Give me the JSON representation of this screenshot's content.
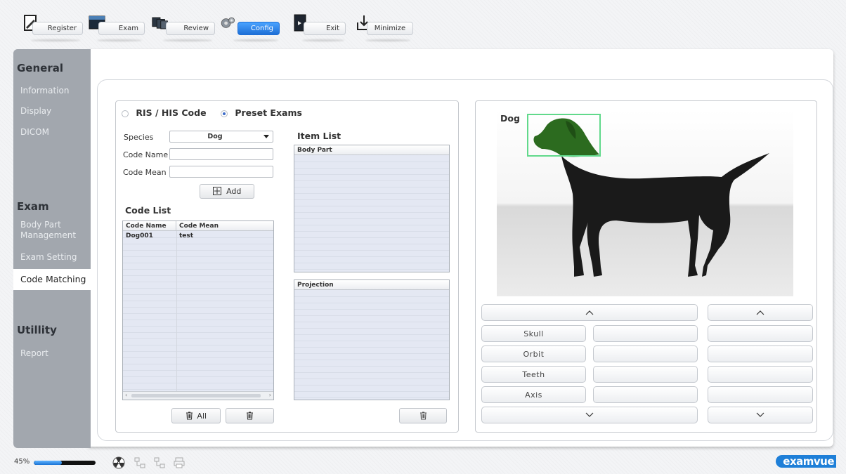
{
  "toolbar": {
    "register": "Register",
    "exam": "Exam",
    "review": "Review",
    "config": "Config",
    "exit": "Exit",
    "minimize": "Minimize"
  },
  "sidebar": {
    "general_header": "General",
    "general_items": [
      "Information",
      "Display",
      "DICOM"
    ],
    "exam_header": "Exam",
    "exam_items": [
      "Body Part\nManagement",
      "Exam Setting",
      "Code Matching"
    ],
    "utility_header": "Utillity",
    "utility_items": [
      "Report"
    ]
  },
  "mode": {
    "ris_his": "RIS / HIS Code",
    "preset": "Preset Exams",
    "selected": "Preset Exams"
  },
  "form": {
    "species_label": "Species",
    "species_value": "Dog",
    "code_name_label": "Code Name",
    "code_name_value": "",
    "code_mean_label": "Code Mean",
    "code_mean_value": "",
    "add_label": "Add"
  },
  "code_list": {
    "title": "Code List",
    "columns": [
      "Code Name",
      "Code Mean"
    ],
    "rows": [
      [
        "Dog001",
        "test"
      ]
    ],
    "delete_all_label": "All"
  },
  "item_list": {
    "title": "Item List",
    "body_part_header": "Body Part",
    "projection_header": "Projection"
  },
  "viewer": {
    "animal": "Dog",
    "selected_region": "head"
  },
  "body_parts": {
    "up": "^",
    "down": "v",
    "column1": [
      "Skull",
      "Orbit",
      "Teeth",
      "Axis"
    ],
    "column2": [
      "",
      "",
      "",
      ""
    ],
    "column3": [
      "",
      "",
      "",
      ""
    ]
  },
  "footer": {
    "percent": "45%",
    "progress": 0.45,
    "logo": "examvue"
  },
  "colors": {
    "accent": "#1e6fd6",
    "sidebar": "#a2a7ae",
    "highlight": "#61d98b",
    "highlight_fill": "#2c6b1f"
  }
}
